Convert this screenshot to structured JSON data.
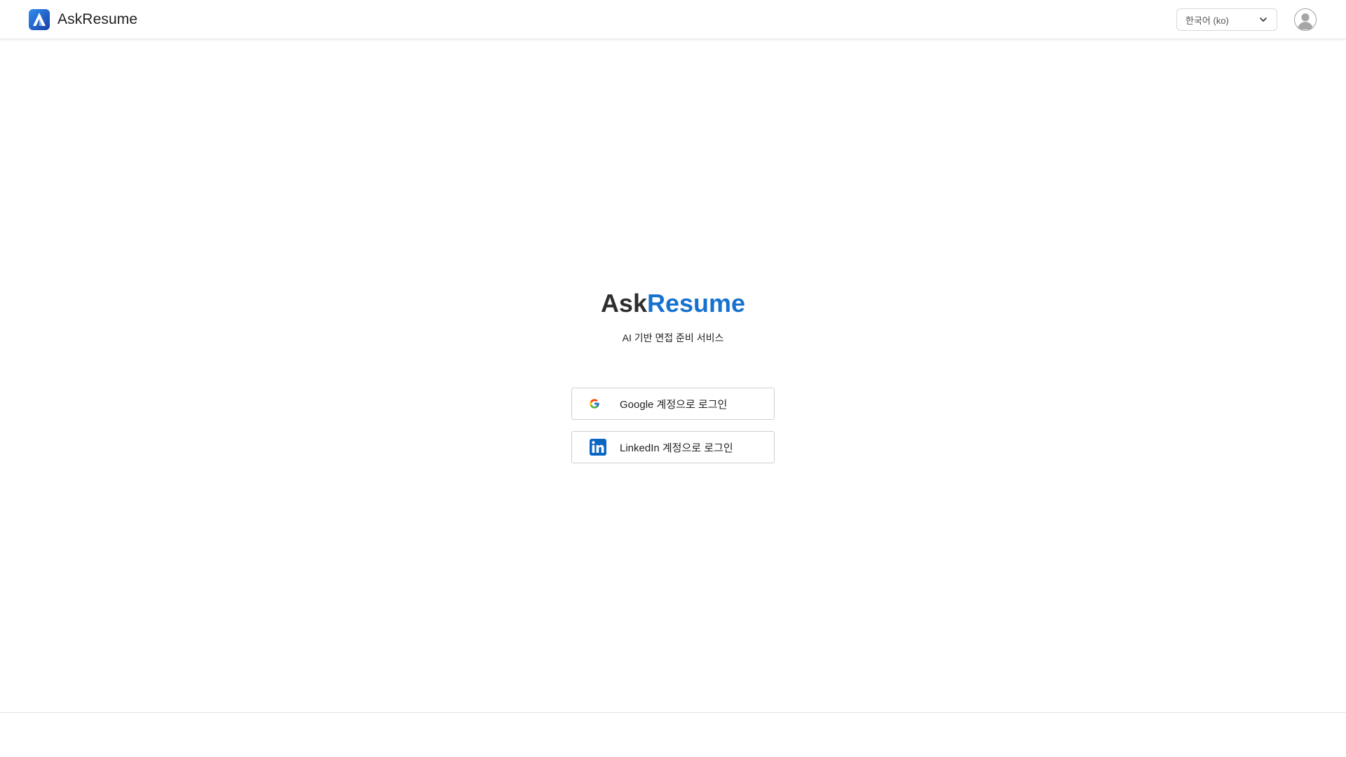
{
  "header": {
    "brand_name": "AskResume",
    "language": {
      "selected": "한국어 (ko)"
    }
  },
  "hero": {
    "title_part1": "Ask",
    "title_part2": "Resume",
    "subtitle": "AI 기반 면접 준비 서비스"
  },
  "login": {
    "google_label": "Google 계정으로 로그인",
    "linkedin_label": "LinkedIn 계정으로 로그인"
  },
  "icons": {
    "brand": "askresume-logo-icon",
    "language_dropdown": "chevron-down-icon",
    "avatar": "user-avatar-icon",
    "google": "google-icon",
    "linkedin": "linkedin-icon"
  },
  "colors": {
    "accent": "#1672cf",
    "linkedin": "#0a66c2",
    "title_dark": "#2e2e2e"
  }
}
